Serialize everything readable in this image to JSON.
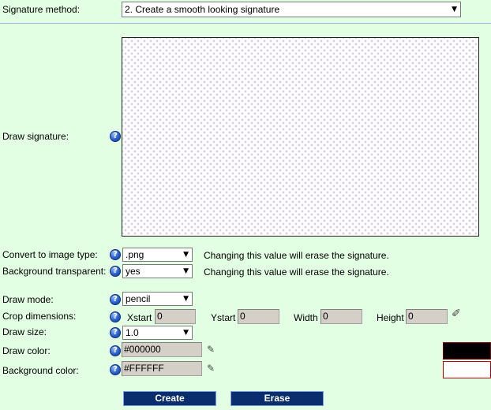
{
  "method": {
    "label": "Signature method:",
    "value": "2. Create a smooth looking signature"
  },
  "draw_signature": {
    "label": "Draw signature:"
  },
  "convert": {
    "label": "Convert to image type:",
    "value": ".png",
    "note": "Changing this value will erase the signature."
  },
  "transparent": {
    "label": "Background transparent:",
    "value": "yes",
    "note": "Changing this value will erase the signature."
  },
  "draw_mode": {
    "label": "Draw mode:",
    "value": "pencil"
  },
  "crop": {
    "label": "Crop dimensions:",
    "xstart_label": "Xstart",
    "xstart_value": "0",
    "ystart_label": "Ystart",
    "ystart_value": "0",
    "width_label": "Width",
    "width_value": "0",
    "height_label": "Height",
    "height_value": "0"
  },
  "draw_size": {
    "label": "Draw size:",
    "value": "1.0"
  },
  "draw_color": {
    "label": "Draw color:",
    "value": "#000000",
    "swatch": "#000000"
  },
  "bg_color": {
    "label": "Background color:",
    "value": "#FFFFFF",
    "swatch": "#FFFFFF"
  },
  "buttons": {
    "create": "Create",
    "erase": "Erase"
  },
  "icons": {
    "help": "?",
    "picker": "✎",
    "brush": "✐"
  }
}
